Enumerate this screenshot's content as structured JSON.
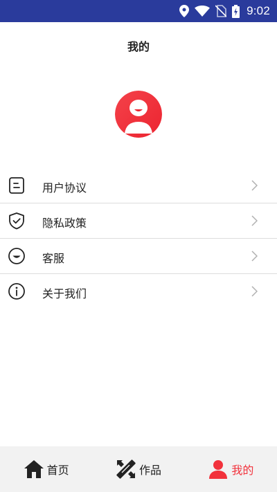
{
  "status_bar": {
    "time": "9:02",
    "icons": [
      "location-icon",
      "wifi-icon",
      "no-sim-icon",
      "battery-charging-icon"
    ]
  },
  "page": {
    "title": "我的"
  },
  "profile": {
    "avatar_icon": "user-avatar-icon"
  },
  "menu": {
    "items": [
      {
        "label": "用户协议",
        "icon": "document-icon"
      },
      {
        "label": "隐私政策",
        "icon": "shield-check-icon"
      },
      {
        "label": "客服",
        "icon": "smile-icon"
      },
      {
        "label": "关于我们",
        "icon": "info-icon"
      }
    ]
  },
  "bottom_nav": {
    "items": [
      {
        "label": "首页",
        "icon": "home-icon",
        "active": false
      },
      {
        "label": "作品",
        "icon": "tools-icon",
        "active": false
      },
      {
        "label": "我的",
        "icon": "user-icon",
        "active": true
      }
    ]
  },
  "colors": {
    "status_bar": "#2a3b9c",
    "accent": "#f2323c",
    "nav_background": "#f2f2f2",
    "divider": "#dcdcdc"
  }
}
